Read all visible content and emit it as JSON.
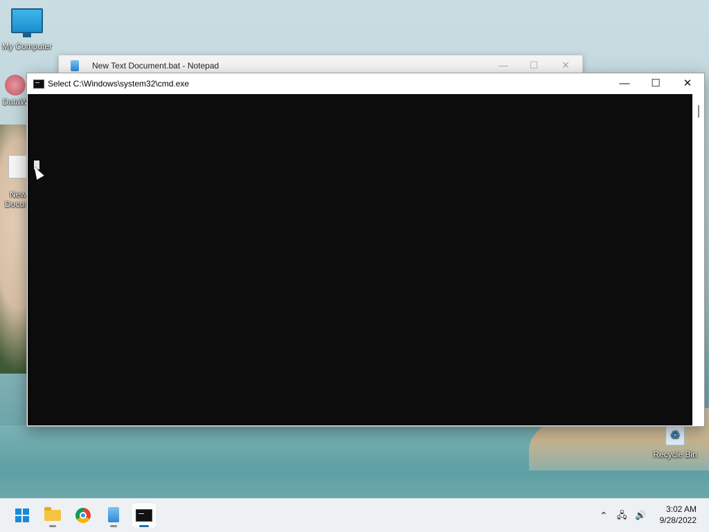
{
  "desktop": {
    "icons": [
      {
        "label": "My Computer"
      },
      {
        "label": "DataW"
      },
      {
        "label": "New\nDocum"
      },
      {
        "label": "Recycle Bin"
      }
    ]
  },
  "notepad": {
    "title": "New Text Document.bat - Notepad",
    "minimize": "—",
    "maximize": "☐",
    "close": "✕"
  },
  "cmd": {
    "title": "Select C:\\Windows\\system32\\cmd.exe",
    "minimize": "—",
    "maximize": "☐",
    "close": "✕",
    "console_bg": "#0c0c0c"
  },
  "taskbar": {
    "items": [
      "start-button",
      "file-explorer",
      "chrome",
      "notepad",
      "command-prompt"
    ],
    "tray": {
      "chevron": "⌃",
      "network": "🖧",
      "volume": "🔊"
    },
    "clock": {
      "time": "3:02 AM",
      "date": "9/28/2022"
    }
  }
}
